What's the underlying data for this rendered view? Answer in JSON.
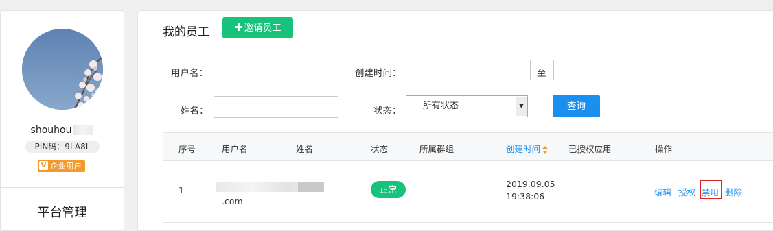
{
  "sidebar": {
    "username": "shouhou",
    "pin": "PIN码：9LA8L",
    "badge": "企业用户",
    "badge_icon": "v-icon",
    "platform": "平台管理"
  },
  "main": {
    "title": "我的员工",
    "invite_button": "邀请员工",
    "filters": {
      "username_label": "用户名：",
      "created_label": "创建时间：",
      "to_label": "至",
      "name_label": "姓名：",
      "status_label": "状态：",
      "status_value": "所有状态",
      "query_button": "查询"
    },
    "table": {
      "headers": {
        "index": "序号",
        "username": "用户名",
        "name": "姓名",
        "status": "状态",
        "group": "所属群组",
        "created": "创建时间",
        "apps": "已授权应用",
        "actions": "操作"
      },
      "rows": [
        {
          "index": "1",
          "username_tail": ".com",
          "status": "正常",
          "created_date": "2019.09.05",
          "created_time": "19:38:06",
          "actions": {
            "edit": "编辑",
            "authorize": "授权",
            "disable": "禁用",
            "sep": "|",
            "delete": "删除"
          }
        }
      ]
    }
  },
  "colors": {
    "green": "#17c27a",
    "blue": "#1b8ff0",
    "orange": "#f39a2b",
    "highlight": "#e02222"
  }
}
